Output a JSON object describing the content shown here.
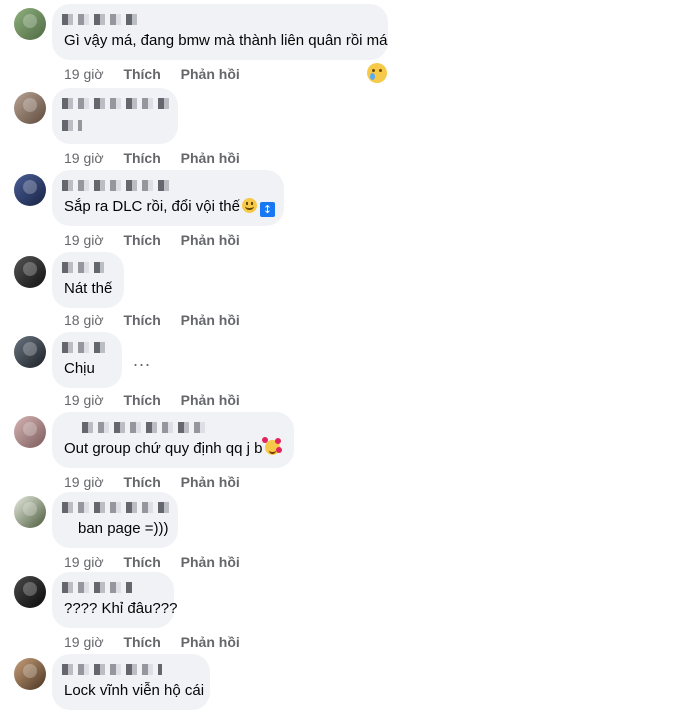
{
  "comments": [
    {
      "text": "Gì vậy má, đang bmw mà thành liên quân rồi má",
      "time": "19 giờ",
      "like": "Thích",
      "reply": "Phản hồi",
      "avatar_color": "#6f8f60"
    },
    {
      "text": "",
      "time": "19 giờ",
      "like": "Thích",
      "reply": "Phản hồi",
      "avatar_color": "#8e7a6a"
    },
    {
      "text": "Sắp ra DLC rồi, đổi vội thế",
      "time": "19 giờ",
      "like": "Thích",
      "reply": "Phản hồi",
      "avatar_color": "#2d3b66",
      "emojis": [
        "smiling-face-emoji",
        "up-down-arrow-emoji"
      ]
    },
    {
      "text": "Nát thế",
      "time": "18 giờ",
      "like": "Thích",
      "reply": "Phản hồi",
      "avatar_color": "#2a2a2a"
    },
    {
      "text": "Chịu",
      "time": "19 giờ",
      "like": "Thích",
      "reply": "Phản hồi",
      "avatar_color": "#3a4048",
      "more": "..."
    },
    {
      "text": "Out group chứ quy định qq j b",
      "time": "19 giờ",
      "like": "Thích",
      "reply": "Phản hồi",
      "avatar_color": "#b08e8e",
      "emojis": [
        "smiling-face-with-hearts-emoji"
      ]
    },
    {
      "text": "ban page =)))",
      "time": "19 giờ",
      "like": "Thích",
      "reply": "Phản hồi",
      "avatar_color": "#4a5a3a"
    },
    {
      "text": "???? Khỉ đâu???",
      "time": "19 giờ",
      "like": "Thích",
      "reply": "Phản hồi",
      "avatar_color": "#1e1e1e"
    },
    {
      "text": "Lock vĩnh viễn hộ cái",
      "time": "",
      "like": "",
      "reply": "",
      "avatar_color": "#8a6a4a"
    }
  ],
  "colors": {
    "bubble": "#f0f2f5",
    "meta": "#65676b",
    "text": "#050505",
    "accent": "#1877f2"
  }
}
